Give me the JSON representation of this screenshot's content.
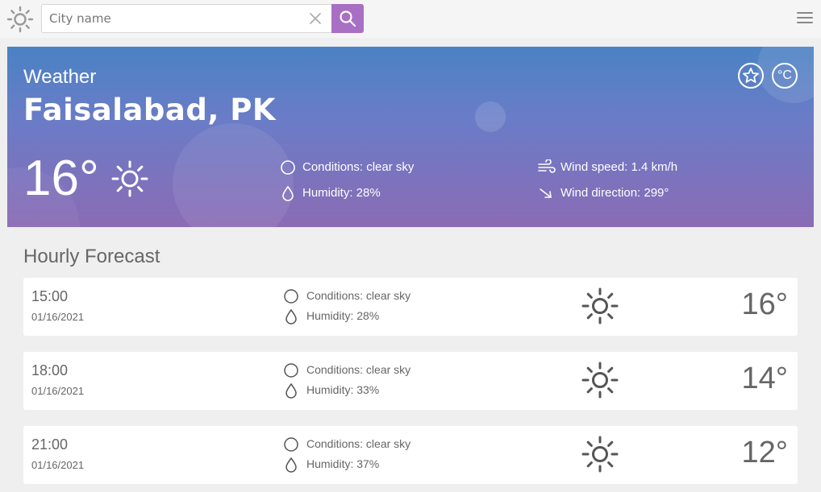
{
  "search": {
    "placeholder": "City name"
  },
  "current": {
    "label": "Weather",
    "city": "Faisalabad, PK",
    "temp": "16°",
    "conditions": "Conditions: clear sky",
    "humidity": "Humidity: 28%",
    "wind_speed": "Wind speed: 1.4 km/h",
    "wind_direction": "Wind direction: 299°",
    "unit": "°C"
  },
  "forecast": {
    "title": "Hourly Forecast",
    "items": [
      {
        "time": "15:00",
        "date": "01/16/2021",
        "conditions": "Conditions: clear sky",
        "humidity": "Humidity: 28%",
        "temp": "16°"
      },
      {
        "time": "18:00",
        "date": "01/16/2021",
        "conditions": "Conditions: clear sky",
        "humidity": "Humidity: 33%",
        "temp": "14°"
      },
      {
        "time": "21:00",
        "date": "01/16/2021",
        "conditions": "Conditions: clear sky",
        "humidity": "Humidity: 37%",
        "temp": "12°"
      }
    ]
  },
  "colors": {
    "accent": "#a86fc4",
    "hero_top": "#4a82c4",
    "hero_bottom": "#8b6bb5"
  }
}
